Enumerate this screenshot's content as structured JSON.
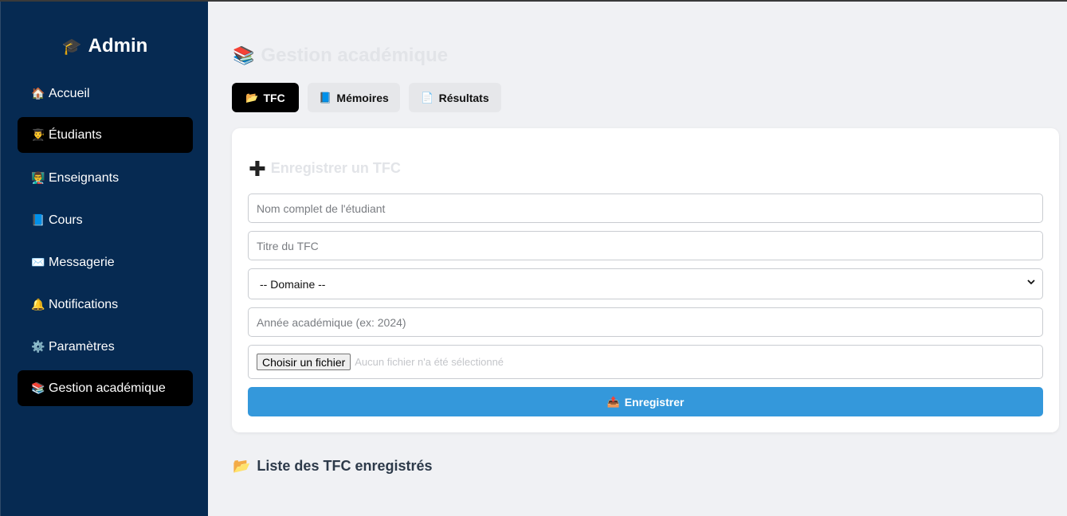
{
  "sidebar": {
    "brand": {
      "icon": "🎓",
      "label": "Admin"
    },
    "items": [
      {
        "icon": "🏠",
        "label": "Accueil",
        "active": false
      },
      {
        "icon": "👨‍🎓",
        "label": "Étudiants",
        "active": true
      },
      {
        "icon": "👨‍🏫",
        "label": "Enseignants",
        "active": false
      },
      {
        "icon": "📘",
        "label": "Cours",
        "active": false
      },
      {
        "icon": "✉️",
        "label": "Messagerie",
        "active": false
      },
      {
        "icon": "🔔",
        "label": "Notifications",
        "active": false
      },
      {
        "icon": "⚙️",
        "label": "Paramètres",
        "active": false
      },
      {
        "icon": "📚",
        "label": "Gestion académique",
        "active": true
      }
    ]
  },
  "main": {
    "title": {
      "icon": "📚",
      "label": "Gestion académique"
    },
    "tabs": [
      {
        "icon": "📂",
        "label": "TFC",
        "active": true
      },
      {
        "icon": "📘",
        "label": "Mémoires",
        "active": false
      },
      {
        "icon": "📄",
        "label": "Résultats",
        "active": false
      }
    ],
    "form": {
      "title_icon": "✚",
      "title": "Enregistrer un TFC",
      "name_placeholder": "Nom complet de l'étudiant",
      "title_placeholder": "Titre du TFC",
      "domain_selected": "-- Domaine --",
      "year_placeholder": "Année académique (ex: 2024)",
      "file_button": "Choisir un fichier",
      "file_status": "Aucun fichier n'a été sélectionné",
      "submit_icon": "📤",
      "submit_label": "Enregistrer"
    },
    "list": {
      "icon": "📂",
      "title": "Liste des TFC enregistrés"
    }
  }
}
